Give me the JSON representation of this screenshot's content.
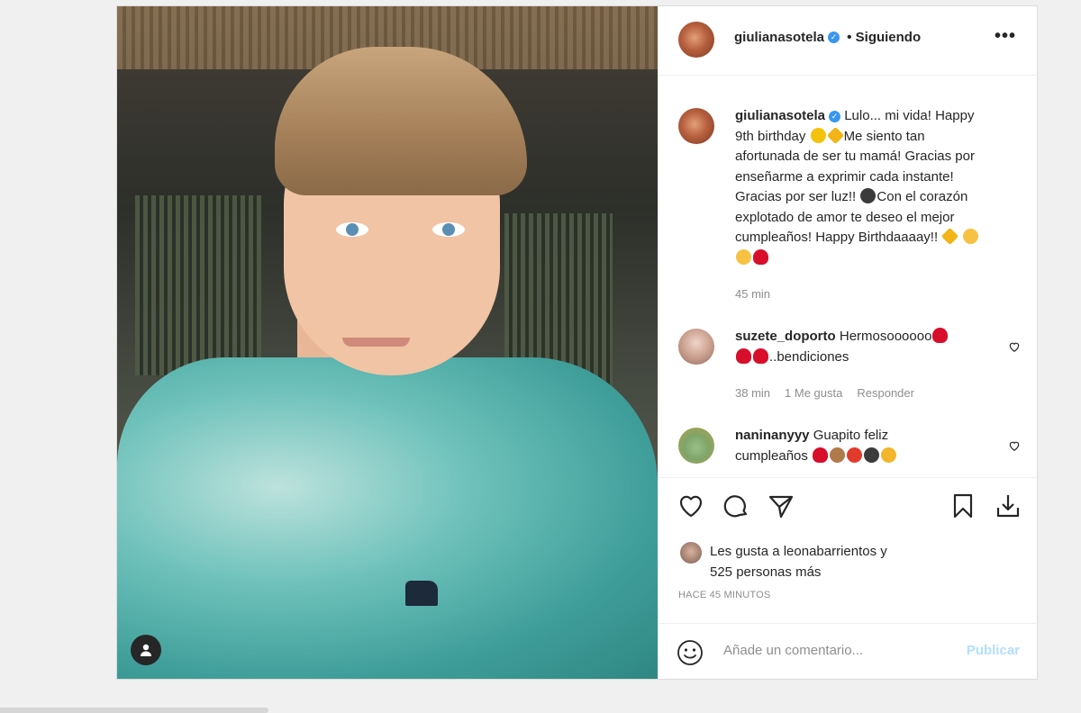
{
  "post": {
    "author": "giulianasotela",
    "separator": "•",
    "follow_status": "Siguiendo",
    "more_label": "•••"
  },
  "caption": {
    "username": "giulianasotela",
    "lines": [
      "Lulo... mi vida! Happy",
      "9th birthday",
      "Me siento tan",
      "afortunada de ser tu mamá! Gracias por",
      "enseñarme a exprimir cada instante!",
      "Gracias por ser luz!!",
      "Con el corazón",
      "explotado de amor te deseo el mejor",
      "cumpleaños! Happy Birthdaaaay!!"
    ],
    "time": "45 min"
  },
  "comments": [
    {
      "username": "suzete_doporto",
      "text_a": "Hermosoooooo",
      "text_b": "..bendiciones",
      "time": "38 min",
      "likes": "1 Me gusta",
      "reply": "Responder"
    },
    {
      "username": "naninanyyy",
      "text_a": "Guapito feliz",
      "text_b": "cumpleaños"
    }
  ],
  "likes": {
    "line1": "Les gusta a leonabarrientos y",
    "line2": "525 personas más"
  },
  "timestamp": "HACE 45 MINUTOS",
  "add_comment": {
    "placeholder": "Añade un comentario...",
    "publish": "Publicar"
  },
  "icons": [
    "heart-icon",
    "comment-icon",
    "share-icon",
    "bookmark-icon",
    "download-icon",
    "smile-icon",
    "user-tag-icon",
    "more-icon"
  ],
  "colors": {
    "link_disabled": "#b2dffc",
    "verified": "#3897f0",
    "meta": "#8e8e8e"
  }
}
